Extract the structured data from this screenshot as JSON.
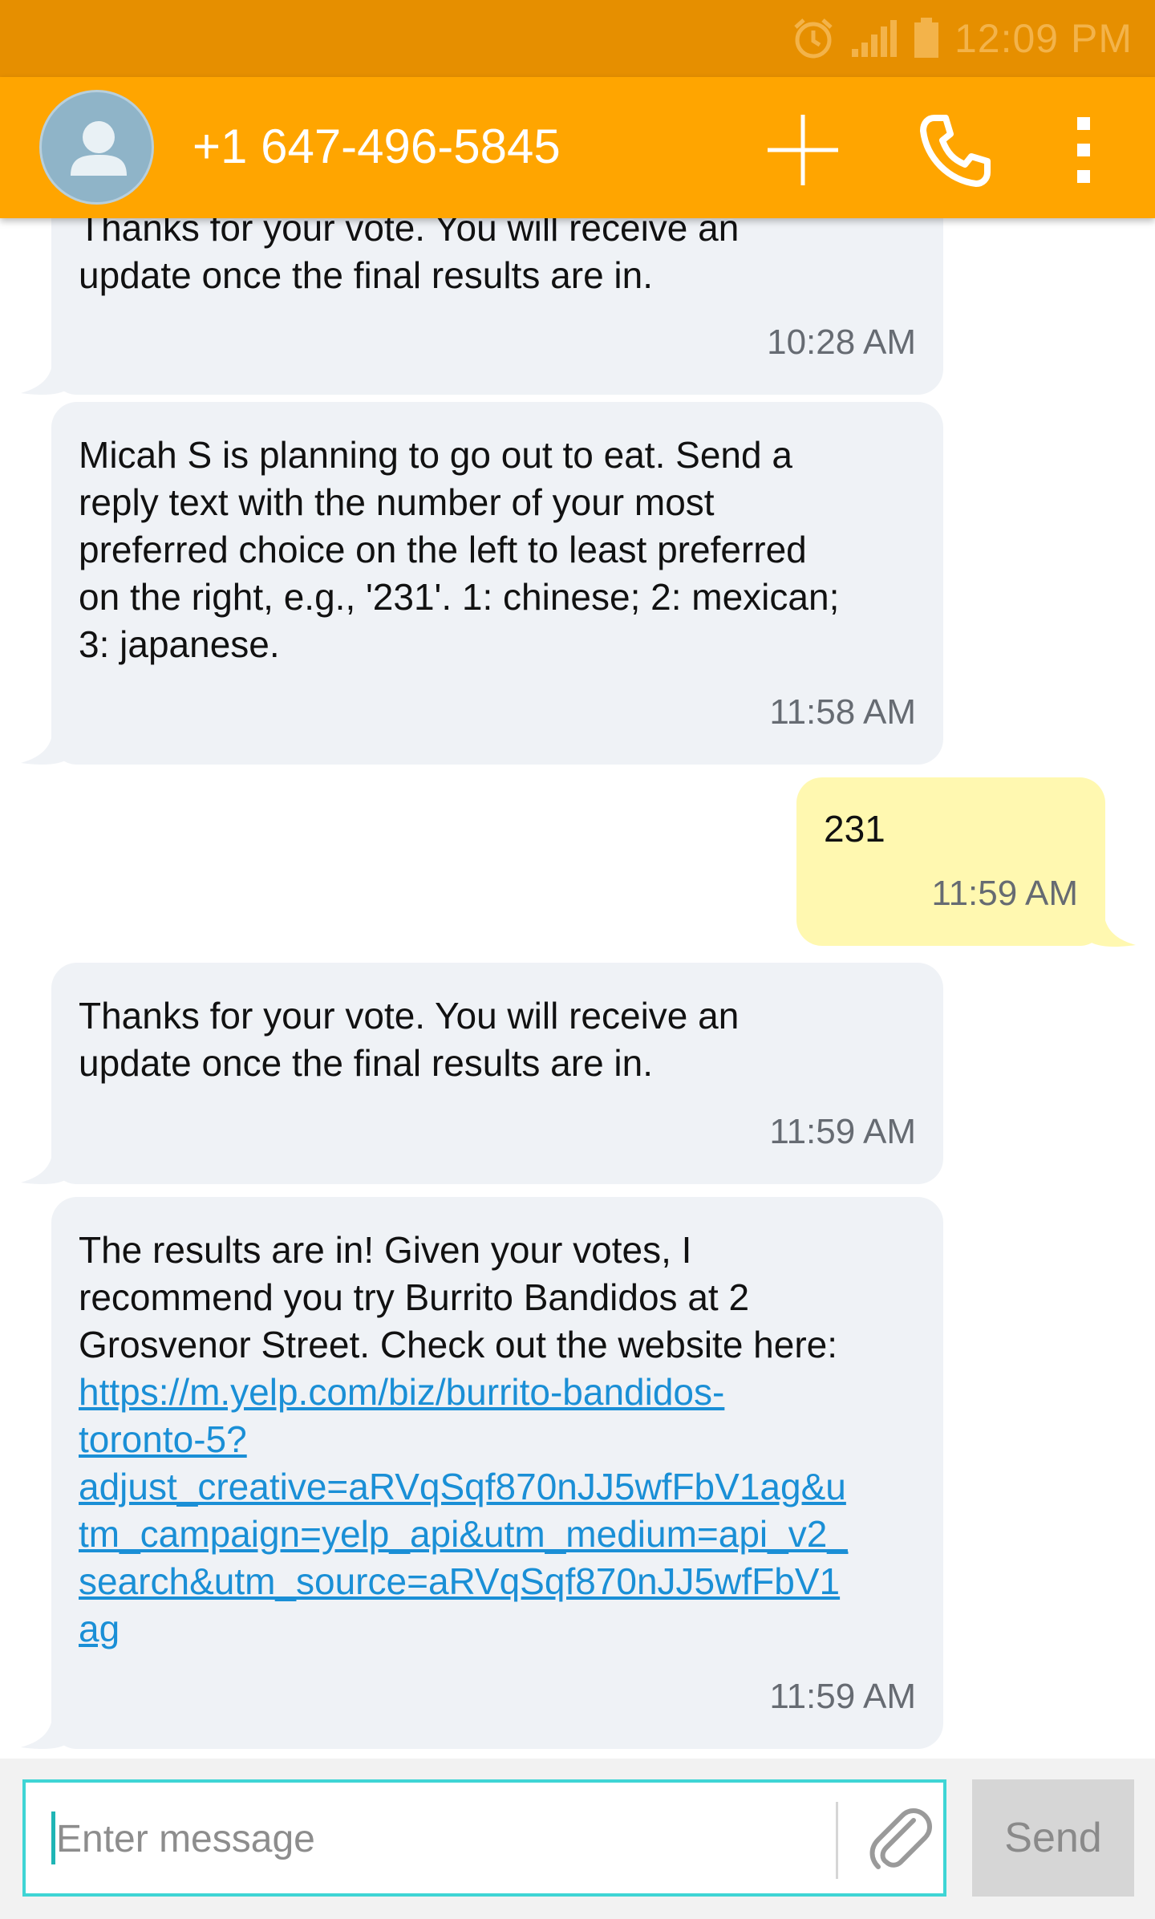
{
  "status_bar": {
    "time": "12:09 PM",
    "icons": [
      "alarm-icon",
      "signal-icon",
      "battery-icon"
    ]
  },
  "app_bar": {
    "contact": "+1 647-496-5845",
    "avatar_icon": "person-icon",
    "actions": [
      "add-icon",
      "phone-icon",
      "more-vert-icon"
    ]
  },
  "messages": [
    {
      "direction": "incoming",
      "text": "Thanks for your vote. You will receive an\nupdate once the final results are in.",
      "time": "10:28 AM"
    },
    {
      "direction": "incoming",
      "text": "Micah S is planning to go out to eat. Send a\nreply text with the number of your most\npreferred choice on the left to least preferred\non the right, e.g., '231'. 1: chinese; 2: mexican;\n3: japanese.",
      "time": "11:58 AM"
    },
    {
      "direction": "outgoing",
      "text": "231",
      "time": "11:59 AM"
    },
    {
      "direction": "incoming",
      "text": "Thanks for your vote. You will receive an\nupdate once the final results are in.",
      "time": "11:59 AM"
    },
    {
      "direction": "incoming",
      "text": "The results are in! Given your votes, I\nrecommend you try Burrito Bandidos at 2\nGrosvenor Street. Check out the website here:",
      "link": "https://m.yelp.com/biz/burrito-bandidos-\ntoronto-5?\nadjust_creative=aRVqSqf870nJJ5wfFbV1ag&u\ntm_campaign=yelp_api&utm_medium=api_v2_\nsearch&utm_source=aRVqSqf870nJJ5wfFbV1\nag",
      "time": "11:59 AM"
    }
  ],
  "composer": {
    "placeholder": "Enter message",
    "value": "",
    "attach_icon": "paperclip-icon",
    "send_label": "Send"
  },
  "colors": {
    "status_bar": "#e68f00",
    "app_bar": "#ffa500",
    "incoming_bubble": "#eff2f6",
    "outgoing_bubble": "#fff8b0",
    "link": "#1a8fd6",
    "input_border": "#3fd5d5"
  }
}
